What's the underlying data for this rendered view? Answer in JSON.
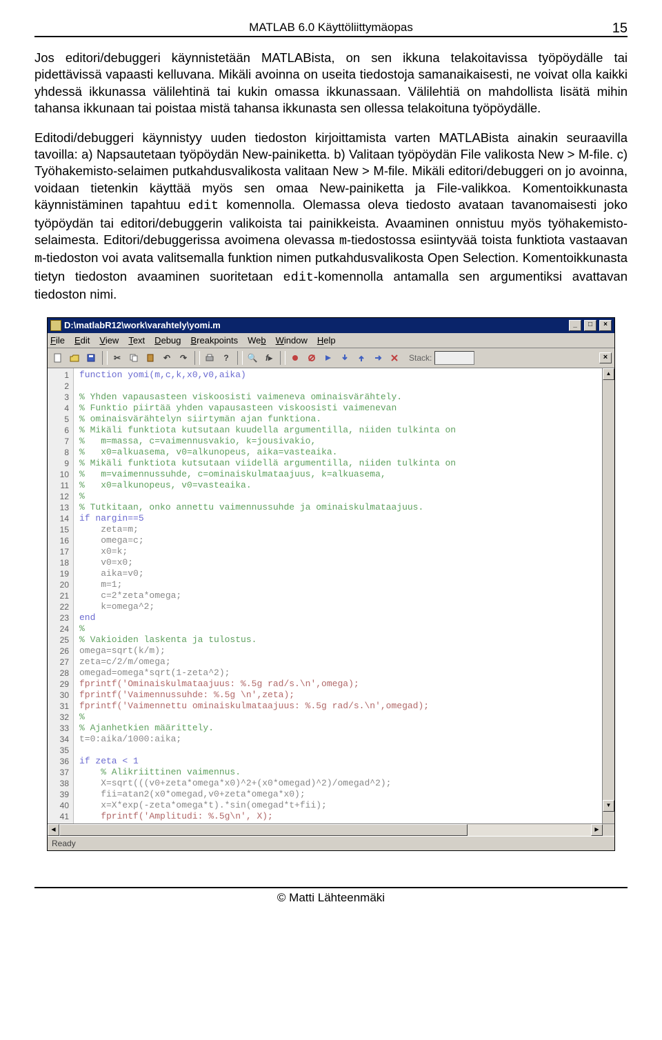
{
  "header": {
    "title": "MATLAB 6.0 Käyttöliittymäopas",
    "page": "15"
  },
  "body": {
    "p1": "Jos editori/debuggeri käynnistetään MATLABista, on sen ikkuna telakoitavissa työpöydälle tai pidettävissä vapaasti kelluvana. Mikäli avoinna on useita tiedostoja samanaikaisesti, ne voivat olla kaikki yhdessä ikkunassa välilehtinä tai kukin omassa ikkunassaan. Välilehtiä on mahdollista lisätä mihin tahansa ikkunaan tai poistaa mistä tahansa ikkunasta sen ollessa telakoituna työpöydälle.",
    "p2a": "Editodi/debuggeri käynnistyy uuden tiedoston kirjoittamista varten MATLABista ainakin seuraavilla tavoilla: a) Napsautetaan työpöydän New-painiketta. b) Valitaan työpöydän File valikosta New > M-file. c) Työhakemisto-selaimen putkahdusvalikosta valitaan New > M-file. Mikäli editori/debuggeri on jo avoinna, voidaan tietenkin käyttää myös sen omaa New-painiketta ja File-valikkoa. Komentoikkunasta käynnistäminen tapahtuu ",
    "p2b": " komennolla. Olemassa oleva tiedosto avataan tavanomaisesti joko työpöydän tai editori/debuggerin valikoista tai painikkeista. Avaaminen onnistuu myös työhakemisto-selaimesta. Editori/debuggerissa avoimena olevassa ",
    "p2c": "-tiedostossa esiintyvää toista funktiota vastaavan ",
    "p2d": "-tiedoston voi avata valitsemalla funktion nimen putkahdusvalikosta Open Selection. Komentoikkunasta tietyn tiedoston avaaminen suoritetaan ",
    "p2e": "-komennolla antamalla sen argumentiksi avattavan tiedoston nimi.",
    "edit": "edit",
    "m": "m"
  },
  "editor": {
    "title": "D:\\matlabR12\\work\\varahtely\\yomi.m",
    "menu": [
      "File",
      "Edit",
      "View",
      "Text",
      "Debug",
      "Breakpoints",
      "Web",
      "Window",
      "Help"
    ],
    "stackLabel": "Stack:",
    "status": "Ready",
    "lines": [
      {
        "n": 1,
        "t": "function yomi(m,c,k,x0,v0,aika)",
        "cls": "kw"
      },
      {
        "n": 2,
        "t": "",
        "cls": ""
      },
      {
        "n": 3,
        "t": "% Yhden vapausasteen viskoosisti vaimeneva ominaisvärähtely.",
        "cls": "cm"
      },
      {
        "n": 4,
        "t": "% Funktio piirtää yhden vapausasteen viskoosisti vaimenevan",
        "cls": "cm"
      },
      {
        "n": 5,
        "t": "% ominaisvärähtelyn siirtymän ajan funktiona.",
        "cls": "cm"
      },
      {
        "n": 6,
        "t": "% Mikäli funktiota kutsutaan kuudella argumentilla, niiden tulkinta on",
        "cls": "cm"
      },
      {
        "n": 7,
        "t": "%   m=massa, c=vaimennusvakio, k=jousivakio,",
        "cls": "cm"
      },
      {
        "n": 8,
        "t": "%   x0=alkuasema, v0=alkunopeus, aika=vasteaika.",
        "cls": "cm"
      },
      {
        "n": 9,
        "t": "% Mikäli funktiota kutsutaan viidellä argumentilla, niiden tulkinta on",
        "cls": "cm"
      },
      {
        "n": 10,
        "t": "%   m=vaimennussuhde, c=ominaiskulmataajuus, k=alkuasema,",
        "cls": "cm"
      },
      {
        "n": 11,
        "t": "%   x0=alkunopeus, v0=vasteaika.",
        "cls": "cm"
      },
      {
        "n": 12,
        "t": "%",
        "cls": "cm"
      },
      {
        "n": 13,
        "t": "% Tutkitaan, onko annettu vaimennussuhde ja ominaiskulmataajuus.",
        "cls": "cm"
      },
      {
        "n": 14,
        "t": "if nargin==5",
        "cls": "kw"
      },
      {
        "n": 15,
        "t": "    zeta=m;",
        "cls": ""
      },
      {
        "n": 16,
        "t": "    omega=c;",
        "cls": ""
      },
      {
        "n": 17,
        "t": "    x0=k;",
        "cls": ""
      },
      {
        "n": 18,
        "t": "    v0=x0;",
        "cls": ""
      },
      {
        "n": 19,
        "t": "    aika=v0;",
        "cls": ""
      },
      {
        "n": 20,
        "t": "    m=1;",
        "cls": ""
      },
      {
        "n": 21,
        "t": "    c=2*zeta*omega;",
        "cls": ""
      },
      {
        "n": 22,
        "t": "    k=omega^2;",
        "cls": ""
      },
      {
        "n": 23,
        "t": "end",
        "cls": "kw"
      },
      {
        "n": 24,
        "t": "%",
        "cls": "cm"
      },
      {
        "n": 25,
        "t": "% Vakioiden laskenta ja tulostus.",
        "cls": "cm"
      },
      {
        "n": 26,
        "t": "omega=sqrt(k/m);",
        "cls": ""
      },
      {
        "n": 27,
        "t": "zeta=c/2/m/omega;",
        "cls": ""
      },
      {
        "n": 28,
        "t": "omegad=omega*sqrt(1-zeta^2);",
        "cls": ""
      },
      {
        "n": 29,
        "t": "fprintf('Ominaiskulmataajuus: %.5g rad/s.\\n',omega);",
        "cls": "st"
      },
      {
        "n": 30,
        "t": "fprintf('Vaimennussuhde: %.5g \\n',zeta);",
        "cls": "st"
      },
      {
        "n": 31,
        "t": "fprintf('Vaimennettu ominaiskulmataajuus: %.5g rad/s.\\n',omegad);",
        "cls": "st"
      },
      {
        "n": 32,
        "t": "%",
        "cls": "cm"
      },
      {
        "n": 33,
        "t": "% Ajanhetkien määrittely.",
        "cls": "cm"
      },
      {
        "n": 34,
        "t": "t=0:aika/1000:aika;",
        "cls": ""
      },
      {
        "n": 35,
        "t": "",
        "cls": ""
      },
      {
        "n": 36,
        "t": "if zeta < 1",
        "cls": "kw"
      },
      {
        "n": 37,
        "t": "    % Alikriittinen vaimennus.",
        "cls": "cm"
      },
      {
        "n": 38,
        "t": "    X=sqrt(((v0+zeta*omega*x0)^2+(x0*omegad)^2)/omegad^2);",
        "cls": ""
      },
      {
        "n": 39,
        "t": "    fii=atan2(x0*omegad,v0+zeta*omega*x0);",
        "cls": ""
      },
      {
        "n": 40,
        "t": "    x=X*exp(-zeta*omega*t).*sin(omegad*t+fii);",
        "cls": ""
      },
      {
        "n": 41,
        "t": "    fprintf('Amplitudi: %.5g\\n', X);",
        "cls": "st"
      }
    ]
  },
  "footer": {
    "text": "© Matti Lähteenmäki"
  }
}
